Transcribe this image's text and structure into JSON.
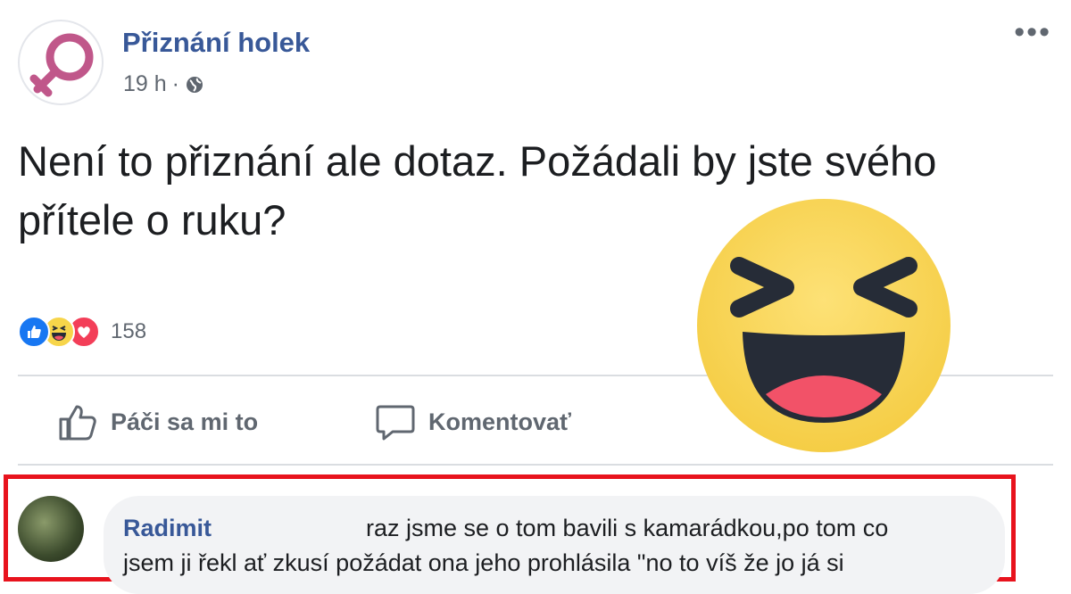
{
  "post": {
    "page_name": "Přiznání holek",
    "time": "19 h",
    "separator": "·",
    "text": "Není to přiznání ale dotaz. Požádali by jste svého přítele o ruku?",
    "reaction_count": "158",
    "reaction_icons": [
      "like-icon",
      "haha-icon",
      "love-icon"
    ]
  },
  "actions": {
    "like_label": "Páči sa mi to",
    "comment_label": "Komentovať"
  },
  "comment": {
    "author": "Radimit",
    "line1": "raz jsme se o tom bavili s kamarádkou,po tom co",
    "line2": "jsem ji řekl ať zkusí požádat ona jeho prohlásila \"no to víš že jo já si"
  },
  "colors": {
    "brand_blue": "#385898",
    "like_blue": "#1877f2",
    "love_red": "#f33e58",
    "haha_yellow": "#f7d54a",
    "highlight_red": "#e8131d",
    "logo_pink": "#c0578a"
  }
}
